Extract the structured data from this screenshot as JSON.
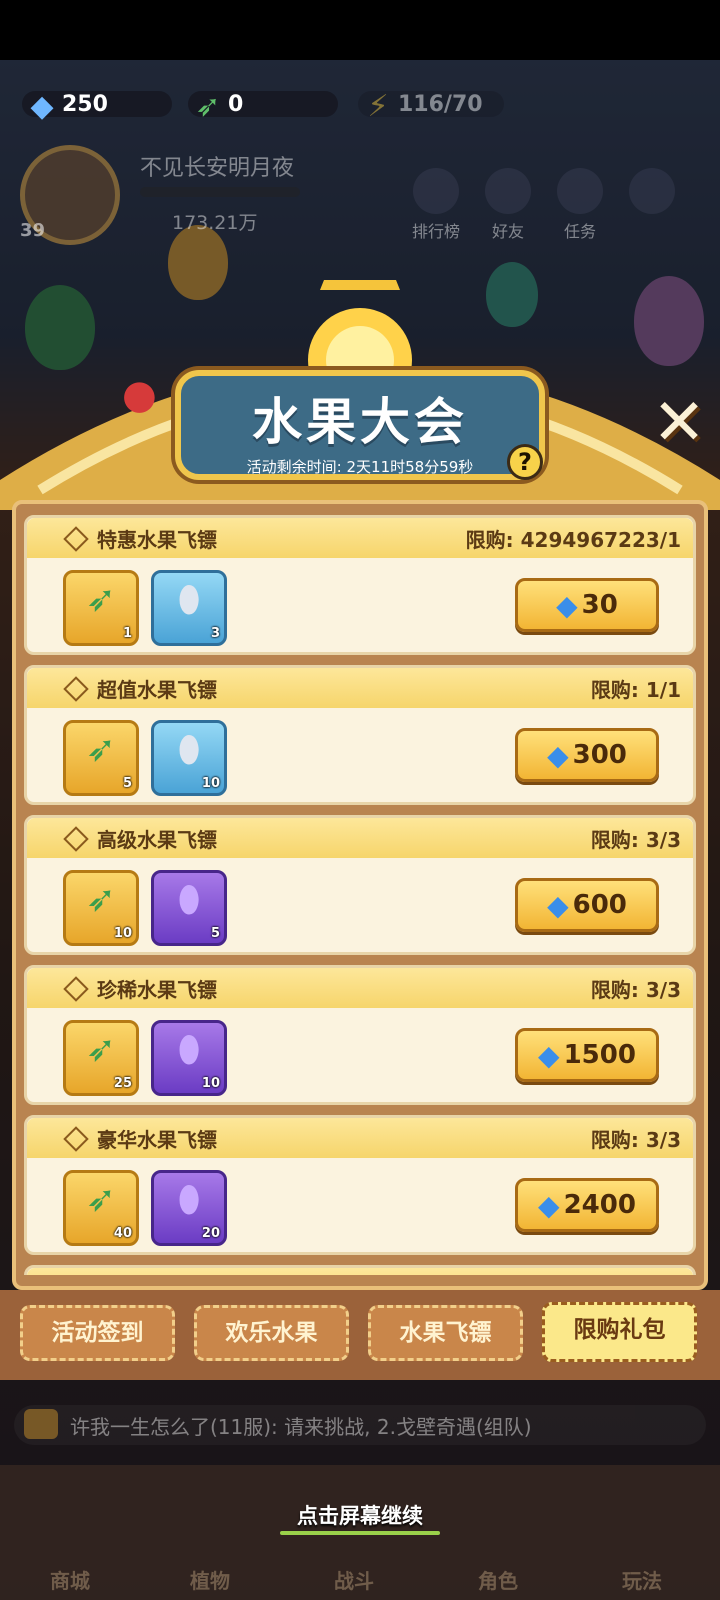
{
  "resources": {
    "gems": "250",
    "darts": "0",
    "energy": "116/70"
  },
  "profile": {
    "name": "不见长安明月夜",
    "level": "39",
    "power": "173.21万"
  },
  "top_buttons": [
    "排行榜",
    "好友",
    "任务"
  ],
  "event": {
    "title": "水果大会",
    "time_remaining": "活动剩余时间: 2天11时58分59秒",
    "help_label": "?"
  },
  "offers": [
    {
      "name": "特惠水果飞镖",
      "limit": "限购: 4294967223/1",
      "items": [
        {
          "type": "dart",
          "qty": "1"
        },
        {
          "type": "capsule-blue",
          "qty": "3"
        }
      ],
      "price": "30"
    },
    {
      "name": "超值水果飞镖",
      "limit": "限购: 1/1",
      "items": [
        {
          "type": "dart",
          "qty": "5"
        },
        {
          "type": "capsule-blue",
          "qty": "10"
        }
      ],
      "price": "300"
    },
    {
      "name": "高级水果飞镖",
      "limit": "限购: 3/3",
      "items": [
        {
          "type": "dart",
          "qty": "10"
        },
        {
          "type": "capsule-purple",
          "qty": "5"
        }
      ],
      "price": "600"
    },
    {
      "name": "珍稀水果飞镖",
      "limit": "限购: 3/3",
      "items": [
        {
          "type": "dart",
          "qty": "25"
        },
        {
          "type": "capsule-purple",
          "qty": "10"
        }
      ],
      "price": "1500"
    },
    {
      "name": "豪华水果飞镖",
      "limit": "限购: 3/3",
      "items": [
        {
          "type": "dart",
          "qty": "40"
        },
        {
          "type": "capsule-purple",
          "qty": "20"
        }
      ],
      "price": "2400"
    }
  ],
  "tabs": [
    "活动签到",
    "欢乐水果",
    "水果飞镖",
    "限购礼包"
  ],
  "active_tab": "限购礼包",
  "chat_message": "许我一生怎么了(11服): 请来挑战, 2.戈壁奇遇(组队)",
  "continue_prompt": "点击屏幕继续",
  "bottom_nav": [
    "商城",
    "植物",
    "战斗",
    "角色",
    "玩法"
  ],
  "colors": {
    "banner": "#3d6b86",
    "gold": "#f0c64c",
    "price_button": "#f2b534"
  }
}
